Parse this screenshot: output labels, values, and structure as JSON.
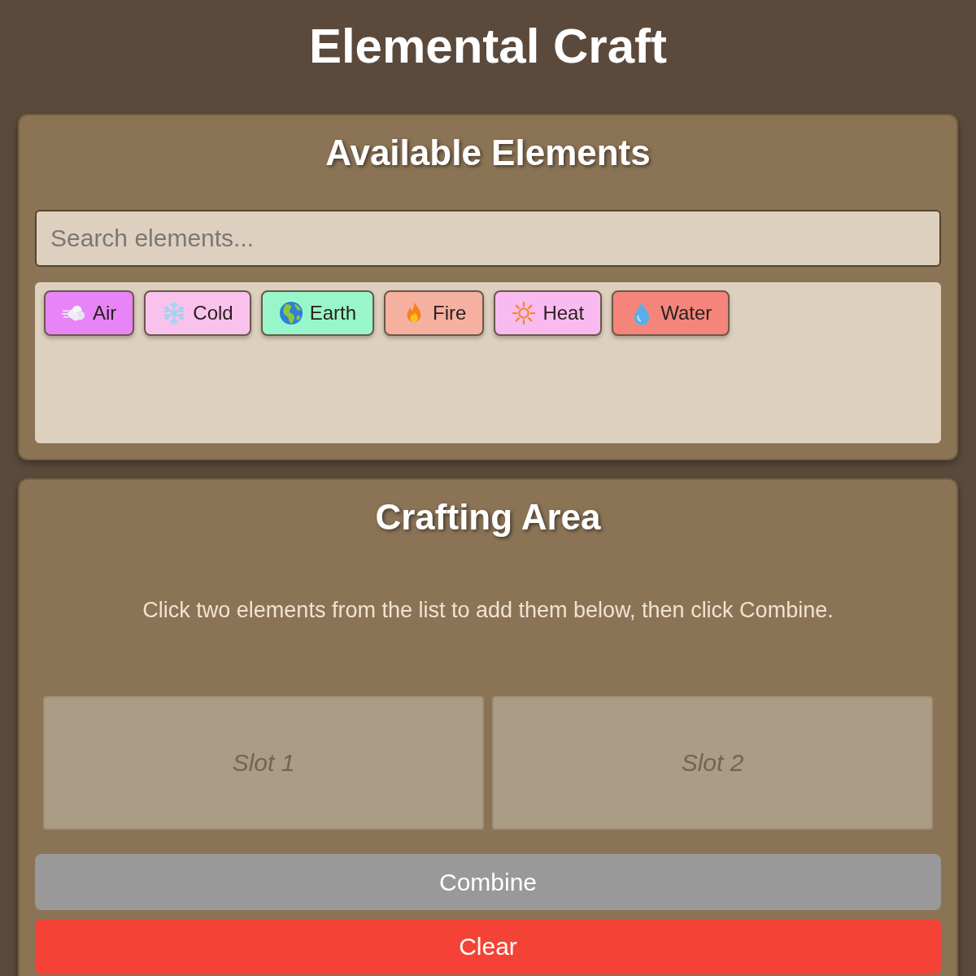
{
  "title": "Elemental Craft",
  "elements_panel": {
    "heading": "Available Elements",
    "search": {
      "placeholder": "Search elements..."
    },
    "elements": [
      {
        "label": "Air",
        "kind": "wind",
        "color": "#e884f7"
      },
      {
        "label": "Cold",
        "kind": "snowflake",
        "color": "#f9c2ec"
      },
      {
        "label": "Earth",
        "kind": "globe",
        "color": "#98f7ca"
      },
      {
        "label": "Fire",
        "kind": "flame",
        "color": "#f5b09f"
      },
      {
        "label": "Heat",
        "kind": "sun",
        "color": "#f9bbef"
      },
      {
        "label": "Water",
        "kind": "droplet",
        "color": "#f5857a"
      }
    ]
  },
  "crafting_panel": {
    "heading": "Crafting Area",
    "instruction": "Click two elements from the list to add them below, then click Combine.",
    "slots": [
      {
        "label": "Slot 1"
      },
      {
        "label": "Slot 2"
      }
    ],
    "combine_button": {
      "label": "Combine",
      "disabled": true
    },
    "clear_button": {
      "label": "Clear"
    }
  }
}
